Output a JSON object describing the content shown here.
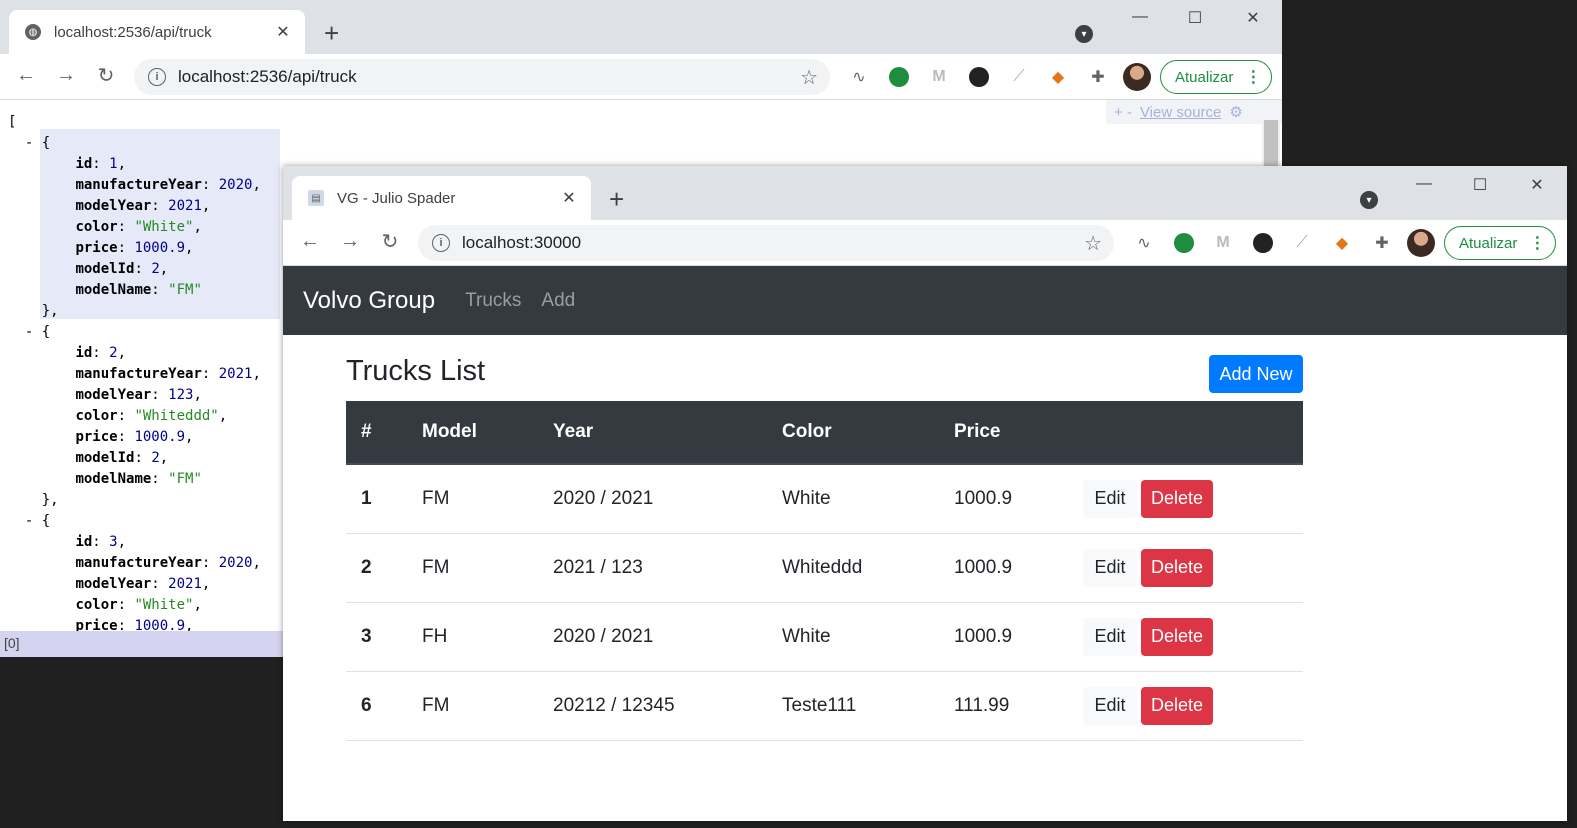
{
  "back_window": {
    "tab_title": "localhost:2536/api/truck",
    "url": "localhost:2536/api/truck",
    "update_label": "Atualizar",
    "view_source": "View source",
    "view_source_prefix": "+ -",
    "status": "[0]",
    "json_lines": [
      [
        "p",
        "["
      ],
      [
        "p",
        "  - {"
      ],
      [
        "kv",
        "id",
        "1",
        "n",
        ","
      ],
      [
        "kv",
        "manufactureYear",
        "2020",
        "n",
        ","
      ],
      [
        "kv",
        "modelYear",
        "2021",
        "n",
        ","
      ],
      [
        "kv",
        "color",
        "\"White\"",
        "s",
        ","
      ],
      [
        "kv",
        "price",
        "1000.9",
        "n",
        ","
      ],
      [
        "kv",
        "modelId",
        "2",
        "n",
        ","
      ],
      [
        "kv",
        "modelName",
        "\"FM\"",
        "s",
        ""
      ],
      [
        "p",
        "    },"
      ],
      [
        "p",
        "  - {"
      ],
      [
        "kv",
        "id",
        "2",
        "n",
        ","
      ],
      [
        "kv",
        "manufactureYear",
        "2021",
        "n",
        ","
      ],
      [
        "kv",
        "modelYear",
        "123",
        "n",
        ","
      ],
      [
        "kv",
        "color",
        "\"Whiteddd\"",
        "s",
        ","
      ],
      [
        "kv",
        "price",
        "1000.9",
        "n",
        ","
      ],
      [
        "kv",
        "modelId",
        "2",
        "n",
        ","
      ],
      [
        "kv",
        "modelName",
        "\"FM\"",
        "s",
        ""
      ],
      [
        "p",
        "    },"
      ],
      [
        "p",
        "  - {"
      ],
      [
        "kv",
        "id",
        "3",
        "n",
        ","
      ],
      [
        "kv",
        "manufactureYear",
        "2020",
        "n",
        ","
      ],
      [
        "kv",
        "modelYear",
        "2021",
        "n",
        ","
      ],
      [
        "kv",
        "color",
        "\"White\"",
        "s",
        ","
      ],
      [
        "kv",
        "price",
        "1000.9",
        "n",
        ","
      ]
    ]
  },
  "front_window": {
    "tab_title": "VG - Julio Spader",
    "url": "localhost:30000",
    "update_label": "Atualizar"
  },
  "app": {
    "brand": "Volvo Group",
    "nav": [
      "Trucks",
      "Add"
    ],
    "page_title": "Trucks List",
    "add_new": "Add New",
    "columns": [
      "#",
      "Model",
      "Year",
      "Color",
      "Price",
      ""
    ],
    "rows": [
      {
        "id": "1",
        "model": "FM",
        "year": "2020 / 2021",
        "color": "White",
        "price": "1000.9"
      },
      {
        "id": "2",
        "model": "FM",
        "year": "2021 / 123",
        "color": "Whiteddd",
        "price": "1000.9"
      },
      {
        "id": "3",
        "model": "FH",
        "year": "2020 / 2021",
        "color": "White",
        "price": "1000.9"
      },
      {
        "id": "6",
        "model": "FM",
        "year": "20212 / 12345",
        "color": "Teste111",
        "price": "111.99"
      }
    ],
    "edit_label": "Edit",
    "delete_label": "Delete"
  },
  "colors": {
    "navbar": "#343a40",
    "primary": "#007bff",
    "danger": "#dc3545",
    "update_green": "#1e8e3e"
  }
}
